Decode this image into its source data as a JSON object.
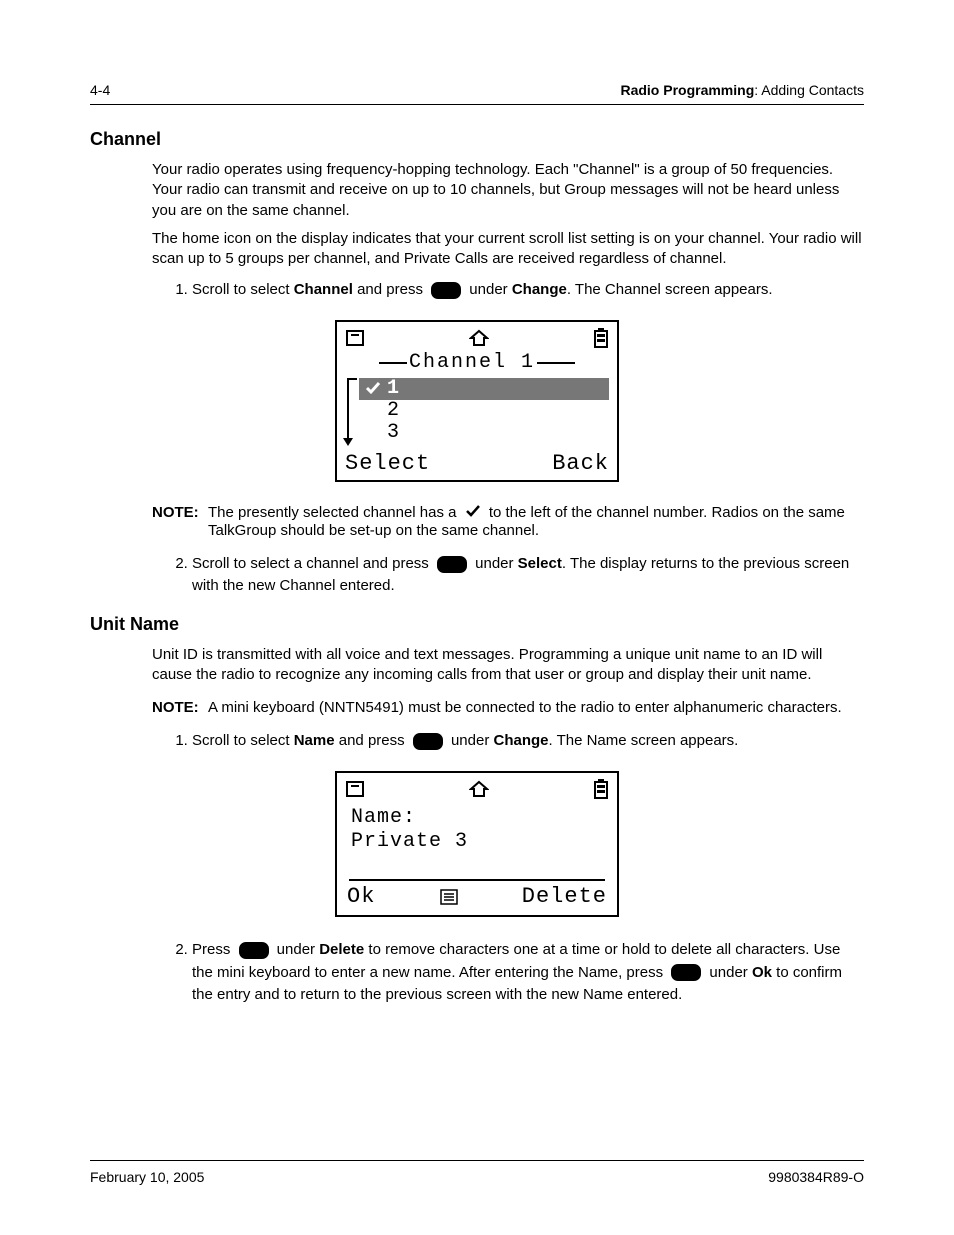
{
  "header": {
    "page_number": "4-4",
    "section_bold": "Radio Programming",
    "section_rest": ": Adding Contacts"
  },
  "channel": {
    "heading": "Channel",
    "para1": "Your radio operates using frequency-hopping technology. Each \"Channel\" is a group of 50 frequencies. Your radio can transmit and receive on up to 10 channels, but Group messages will not be heard unless you are on the same channel.",
    "para2": "The home icon on the display indicates that your current scroll list setting is on your channel. Your radio will scan up to 5 groups per channel, and Private Calls are received regardless of channel.",
    "step1_pre": "Scroll to select ",
    "step1_bold1": "Channel",
    "step1_mid": " and press ",
    "step1_under": " under ",
    "step1_bold2": "Change",
    "step1_post": ". The Channel screen appears.",
    "note_label": "NOTE:",
    "note_pre": "The presently selected channel has a ",
    "note_post": " to the left of the channel number. Radios on the same TalkGroup should be set-up on the same channel.",
    "step2_pre": "Scroll to select a channel and press ",
    "step2_under": " under ",
    "step2_bold": "Select",
    "step2_post": ". The display returns to the previous screen with the new Channel entered.",
    "screen": {
      "title": "Channel 1",
      "items": [
        "1",
        "2",
        "3"
      ],
      "left_soft": "Select",
      "right_soft": "Back"
    }
  },
  "unitname": {
    "heading": "Unit Name",
    "para1": "Unit ID is transmitted with all voice and text messages. Programming a unique unit name to an ID will cause the radio to recognize any incoming calls from that user or group and display their unit name.",
    "note_label": "NOTE:",
    "note_text": "A mini keyboard (NNTN5491) must be connected to the radio to enter alphanumeric characters.",
    "step1_pre": "Scroll to select ",
    "step1_bold1": "Name",
    "step1_mid": " and press ",
    "step1_under": " under ",
    "step1_bold2": "Change",
    "step1_post": ". The Name screen appears.",
    "step2_a": "Press ",
    "step2_b": " under ",
    "step2_bold_del": "Delete",
    "step2_c": " to remove characters one at a time or hold to delete all characters. Use the mini keyboard to enter a new name. After entering the Name, press ",
    "step2_d": " under ",
    "step2_bold_ok": "Ok",
    "step2_e": " to confirm the entry and to return to the previous screen with the new Name entered.",
    "screen": {
      "label": "Name:",
      "value": "Private 3",
      "left_soft": "Ok",
      "right_soft": "Delete"
    }
  },
  "footer": {
    "date": "February 10, 2005",
    "docnum": "9980384R89-O"
  }
}
